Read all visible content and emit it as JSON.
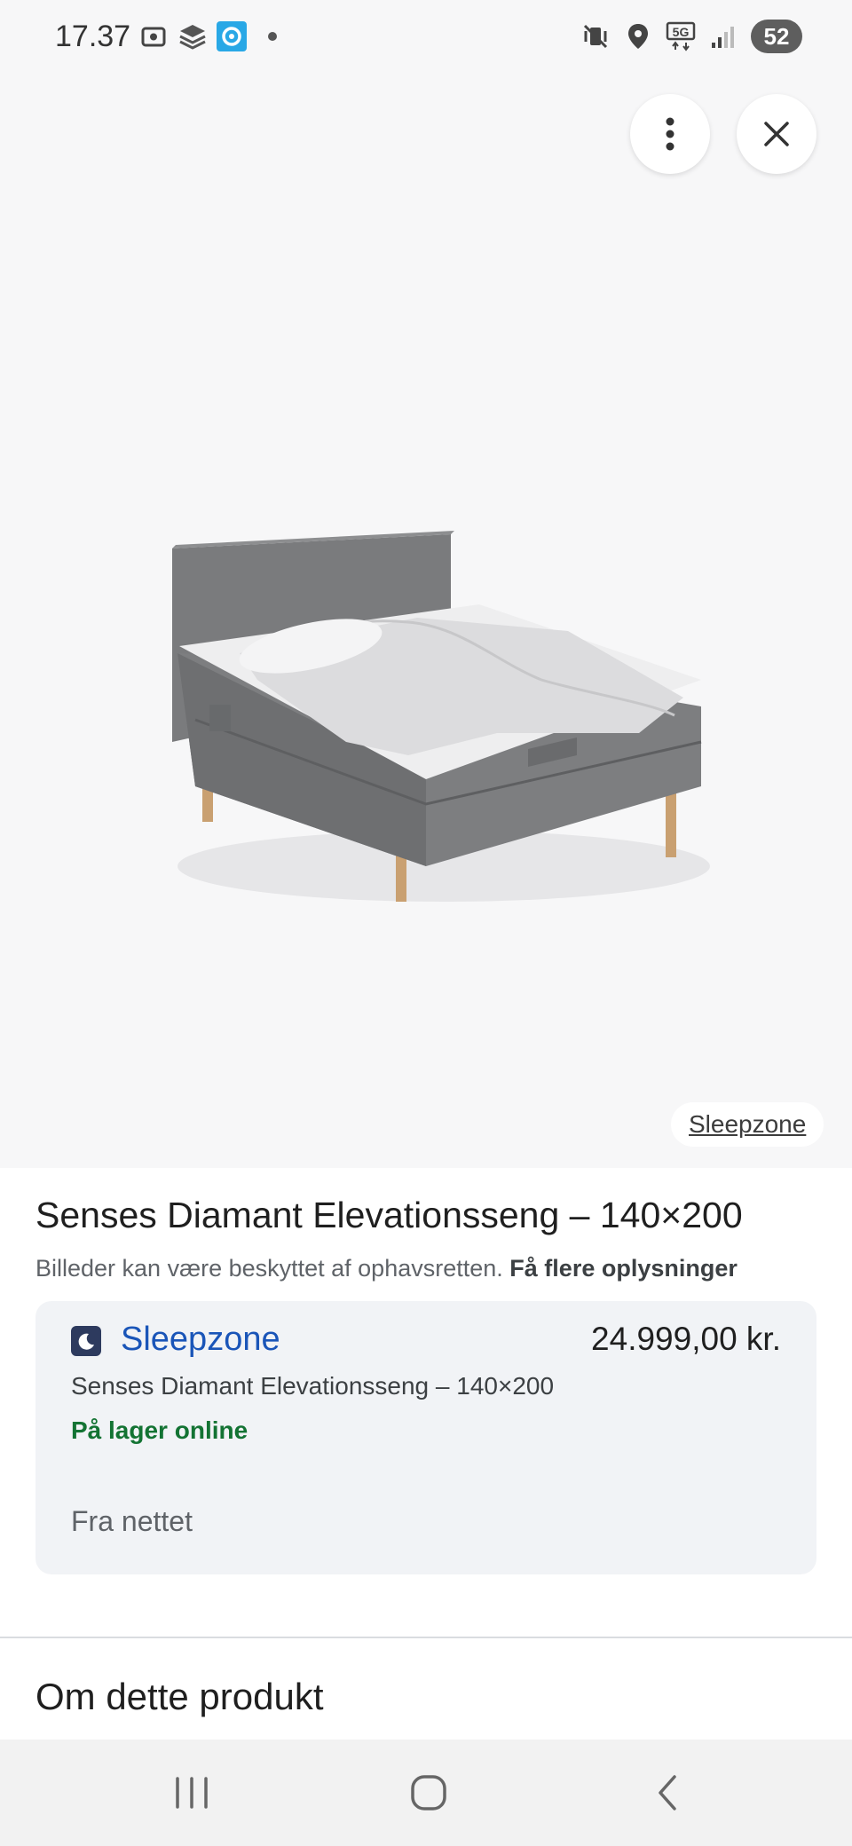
{
  "status_bar": {
    "time": "17.37",
    "battery": "52",
    "network": "5G",
    "left_icons": [
      "screenshot-icon",
      "stack-icon",
      "app-icon"
    ],
    "right_icons": [
      "mute-vibrate-icon",
      "location-icon",
      "5g-icon",
      "signal-icon",
      "battery-icon"
    ]
  },
  "viewer": {
    "source_chip": "Sleepzone",
    "more_icon": "more-vert-icon",
    "close_icon": "close-icon"
  },
  "product": {
    "title": "Senses Diamant Elevationsseng – 140×200",
    "copyright_text": "Billeder kan være beskyttet af ophavsretten.",
    "more_info_link": "Få flere oplysninger"
  },
  "offer": {
    "merchant": "Sleepzone",
    "price": "24.999,00 kr.",
    "title": "Senses Diamant Elevationsseng – 140×200",
    "stock": "På lager online",
    "source_label": "Fra nettet"
  },
  "section": {
    "title": "Om dette produkt"
  },
  "nav_bar": {
    "buttons": [
      "recent-apps-icon",
      "home-icon",
      "back-icon"
    ]
  },
  "colors": {
    "link_blue": "#1a55b8",
    "stock_green": "#137333",
    "card_bg": "#f1f3f6",
    "image_bg": "#f7f7f8"
  }
}
